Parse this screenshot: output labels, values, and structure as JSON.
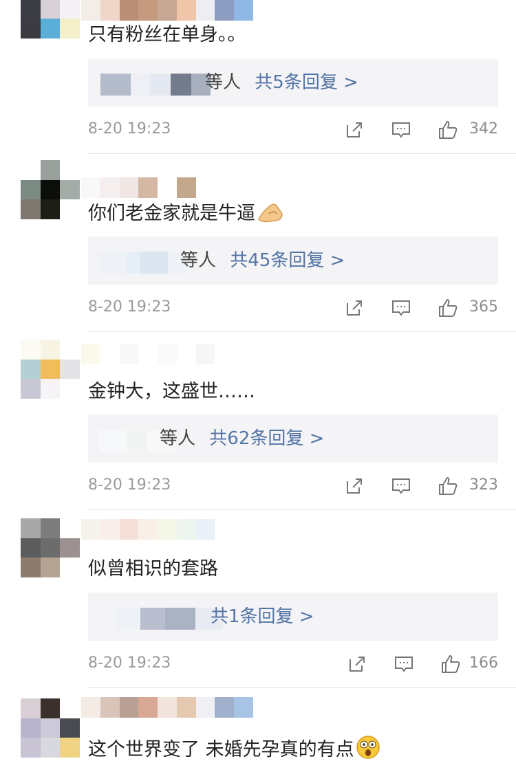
{
  "comments": [
    {
      "text": "只有粉丝在单身。。",
      "reply_who": "等人",
      "reply_more": "共5条回复 >",
      "time": "8-20 19:23",
      "likes": "342",
      "avatar_colors": [
        "#2f2f33",
        "#cfc8d0",
        "#ece6ee",
        "#3b3d44",
        "#d8d2d8",
        "#f4f0f4",
        "#3a3a40",
        "#5aaed8",
        "#f4efc8"
      ],
      "name_colors": [
        "#f3ede8",
        "#f0d6c8",
        "#b88e74",
        "#c69a7e",
        "#c7a794",
        "#f0c6a8",
        "#eeeef2",
        "#8d9cc2",
        "#8fb8e4"
      ]
    },
    {
      "text": "你们老金家就是牛逼",
      "reply_who": "等人",
      "reply_more": "共45条回复 >",
      "time": "8-20 19:23",
      "likes": "365",
      "avatar_colors": [
        "#ffffff",
        "#9aa09c",
        "#ffffff",
        "#7c8a84",
        "#0c0e0c",
        "#a4aca8",
        "#7e7870",
        "#1e1e18",
        "#ffffff"
      ],
      "name_colors": [
        "#f8f8f8",
        "#f4eeee",
        "#f0e6e4",
        "#d4b8a4",
        "#ffffff",
        "#c4a88e",
        "#ffffff",
        "#ffffff",
        "#ffffff"
      ]
    },
    {
      "text": "金钟大，这盛世……",
      "reply_who": "等人",
      "reply_more": "共62条回复 >",
      "time": "8-20 19:23",
      "likes": "323",
      "avatar_colors": [
        "#fbfbf4",
        "#f8f4e4",
        "#ffffff",
        "#b4d0d4",
        "#f0bc5c",
        "#e4e4e8",
        "#c8c8d4",
        "#f6f4f6",
        "#ffffff"
      ],
      "name_colors": [
        "#fbf8ec",
        "#ffffff",
        "#f8f8f8",
        "#ffffff",
        "#fafafa",
        "#ffffff",
        "#f6f6f6",
        "#ffffff",
        "#ffffff"
      ]
    },
    {
      "text": "似曾相识的套路",
      "reply_who": "",
      "reply_more": "共1条回复 >",
      "time": "8-20 19:23",
      "likes": "166",
      "avatar_colors": [
        "#a8a8a8",
        "#7c7c7c",
        "#ffffff",
        "#5c5c5c",
        "#6c6c6c",
        "#9c9090",
        "#8c7c70",
        "#b4a494",
        "#ffffff"
      ],
      "name_colors": [
        "#f6f2ec",
        "#f8eeea",
        "#f4e0d8",
        "#f8f0e6",
        "#f4f6e8",
        "#eef4ee",
        "#eaf0f8",
        "#ffffff",
        "#ffffff"
      ]
    },
    {
      "text": "这个世界变了 未婚先孕真的有点",
      "time": "",
      "likes": "",
      "avatar_colors": [
        "#d8d0d4",
        "#3c302c",
        "#ffffff",
        "#b8b4cc",
        "#cccad8",
        "#4a4a52",
        "#c8c4d4",
        "#d8d8e0",
        "#f0d484"
      ],
      "name_colors": [
        "#f4ece4",
        "#d8c4b8",
        "#b8a094",
        "#d8a894",
        "#f0e4dc",
        "#e4c8b0",
        "#f0f0f4",
        "#a0b0cc",
        "#a8c4e4"
      ]
    }
  ]
}
